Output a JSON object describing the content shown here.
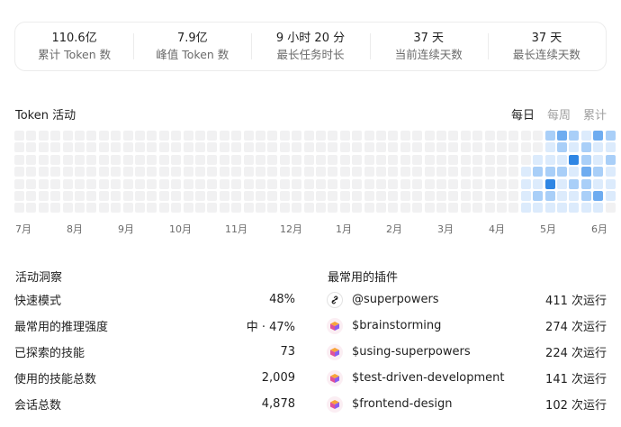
{
  "stats": [
    {
      "value": "110.6亿",
      "label": "累计 Token 数"
    },
    {
      "value": "7.9亿",
      "label": "峰值 Token 数"
    },
    {
      "value": "9 小时 20 分",
      "label": "最长任务时长"
    },
    {
      "value": "37 天",
      "label": "当前连续天数"
    },
    {
      "value": "37 天",
      "label": "最长连续天数"
    }
  ],
  "activity": {
    "title": "Token 活动",
    "tabs": [
      "每日",
      "每周",
      "累计"
    ],
    "active_tab": "每日",
    "months": [
      "7月",
      "8月",
      "9月",
      "10月",
      "11月",
      "12月",
      "1月",
      "2月",
      "3月",
      "4月",
      "5月",
      "6月"
    ],
    "colors": {
      "empty": "#f1f1f2",
      "level1": "#dcebfc",
      "level2": "#a9cff8",
      "level3": "#6eacf0",
      "level4": "#2f86e4"
    },
    "active_weeks_levels": [
      [
        0,
        0,
        0,
        1,
        1,
        1,
        1
      ],
      [
        0,
        0,
        1,
        2,
        1,
        2,
        1
      ],
      [
        2,
        1,
        1,
        2,
        4,
        2,
        1
      ],
      [
        3,
        2,
        1,
        2,
        1,
        1,
        1
      ],
      [
        2,
        1,
        4,
        1,
        2,
        1,
        1
      ],
      [
        1,
        2,
        2,
        3,
        2,
        2,
        1
      ],
      [
        3,
        1,
        1,
        2,
        1,
        3,
        1
      ],
      [
        2,
        1,
        2,
        1,
        1,
        1,
        0
      ]
    ]
  },
  "insights": {
    "title": "活动洞察",
    "rows": [
      {
        "label": "快速模式",
        "value": "48%"
      },
      {
        "label": "最常用的推理强度",
        "value": "中 · 47%"
      },
      {
        "label": "已探索的技能",
        "value": "73"
      },
      {
        "label": "使用的技能总数",
        "value": "2,009"
      },
      {
        "label": "会话总数",
        "value": "4,878"
      }
    ]
  },
  "plugins": {
    "title": "最常用的插件",
    "rows": [
      {
        "name": "@superpowers",
        "count": "411 次运行",
        "icon": "link-icon"
      },
      {
        "name": "$brainstorming",
        "count": "274 次运行",
        "icon": "cube-icon"
      },
      {
        "name": "$using-superpowers",
        "count": "224 次运行",
        "icon": "cube-icon"
      },
      {
        "name": "$test-driven-development",
        "count": "141 次运行",
        "icon": "cube-icon"
      },
      {
        "name": "$frontend-design",
        "count": "102 次运行",
        "icon": "cube-icon"
      }
    ]
  }
}
